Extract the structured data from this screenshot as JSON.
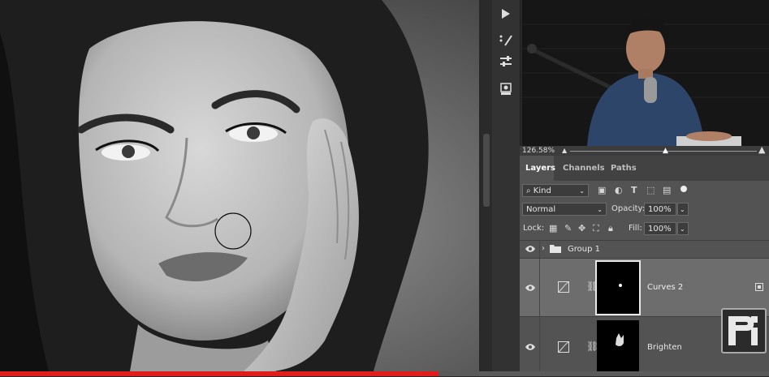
{
  "zoom": {
    "label": "126.58%"
  },
  "panel": {
    "tabs": [
      "Layers",
      "Channels",
      "Paths"
    ],
    "filter": {
      "kind_label": "Kind"
    },
    "blend_mode": "Normal",
    "opacity": {
      "label": "Opacity:",
      "value": "100%"
    },
    "lock": {
      "label": "Lock:"
    },
    "fill": {
      "label": "Fill:",
      "value": "100%"
    },
    "layers": [
      {
        "name": "Group 1",
        "type": "group"
      },
      {
        "name": "Curves 2",
        "type": "adjustment"
      },
      {
        "name": "Brighten",
        "type": "adjustment"
      }
    ]
  },
  "video": {
    "progress": 0.57
  },
  "colors": {
    "progress_red": "#e01c1c",
    "panel_bg": "#535353",
    "selected_layer": "#6d6d6d"
  }
}
